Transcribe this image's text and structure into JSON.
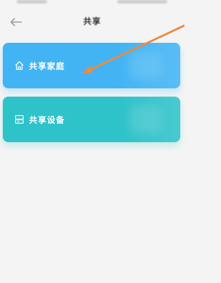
{
  "header": {
    "title": "共享"
  },
  "cards": [
    {
      "label": "共享家庭",
      "icon": "home-icon",
      "color": "#42b4f4"
    },
    {
      "label": "共享设备",
      "icon": "device-icon",
      "color": "#2ec2c9"
    }
  ],
  "annotation": {
    "type": "arrow",
    "color": "#f08a3c"
  },
  "colors": {
    "background": "#f4f4f5",
    "title": "#333333",
    "back_icon": "#9a9a9a"
  }
}
